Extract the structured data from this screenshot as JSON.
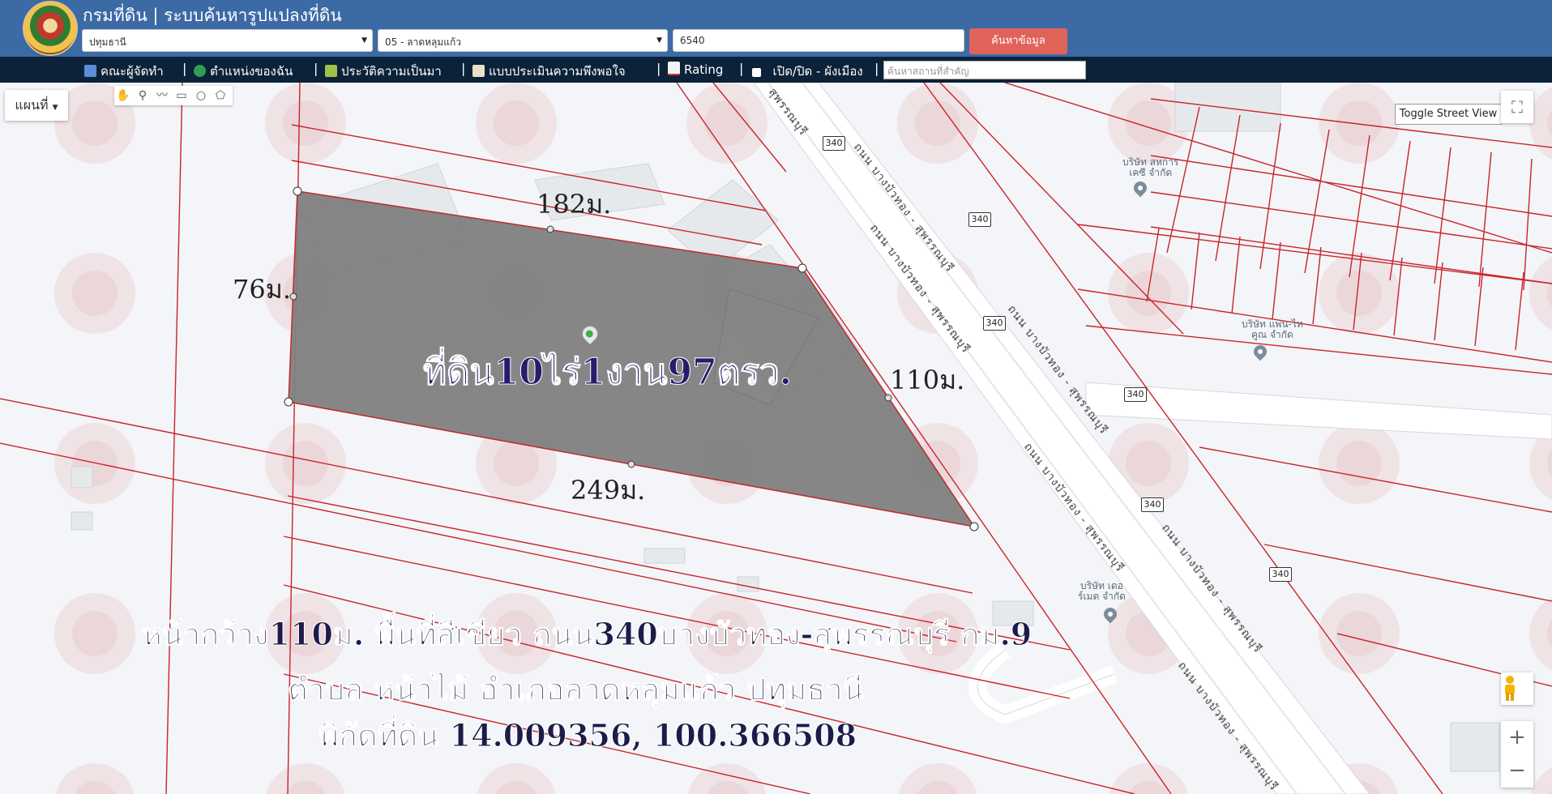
{
  "header": {
    "title": "กรมที่ดิน | ระบบค้นหารูปแปลงที่ดิน",
    "province": "ปทุมธานี",
    "district": "05 - ลาดหลุมแก้ว",
    "parcel_number": "6540",
    "search_button": "ค้นหาข้อมูล"
  },
  "menu": {
    "items": [
      {
        "label": "คณะผู้จัดทำ",
        "icon": "people-icon"
      },
      {
        "label": "ตำแหน่งของฉัน",
        "icon": "globe-icon"
      },
      {
        "label": "ประวัติความเป็นมา",
        "icon": "plant-icon"
      },
      {
        "label": "แบบประเมินความพึงพอใจ",
        "icon": "form-icon"
      },
      {
        "label": "Rating",
        "icon": "chart-icon"
      },
      {
        "label": "เปิด/ปิด - ผังเมือง",
        "icon": "checkbox-icon"
      }
    ],
    "place_search_placeholder": "ค้นหาสถานที่สำคัญ"
  },
  "map": {
    "map_type_button": "แผนที่",
    "street_view_button": "Toggle Street View",
    "zoom_in": "+",
    "zoom_out": "−",
    "road_number": "340",
    "road_name": "ถนน บางบัวทอง - สุพรรณบุรี",
    "road_name_short": "สุพรรณบุรี",
    "poi": [
      {
        "name_line1": "บริษัท สหการ",
        "name_line2": "เคซี จำกัด"
      },
      {
        "name_line1": "บริษัท แพน-ไท",
        "name_line2": "คูณ จำกัด"
      },
      {
        "name_line1": "บริษัท เดอ",
        "name_line2": "ร์เมด จำกัด"
      }
    ]
  },
  "parcel": {
    "area_label": "ที่ดิน10ไร่1งาน97ตรว.",
    "side_top": "182ม.",
    "side_left": "76ม.",
    "side_right": "110ม.",
    "side_bottom": "249ม.",
    "fill_color": "#7f7f7f",
    "boundary_color": "#c0282d"
  },
  "caption": {
    "line1": "หน้ากว้าง110ม. พื้นที่สีเขียว ถนน340บางบัวทอง-สุพรรณบุรี กม.9",
    "line2": "ตำบล หน้าไม้ อำเภอลาดหลุมแก้ว ปทุมธานี",
    "line3": "พิกัดที่ดิน 14.009356, 100.366508"
  }
}
